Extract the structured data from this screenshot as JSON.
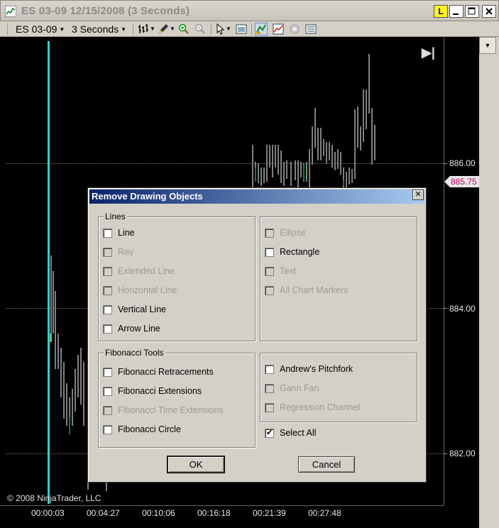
{
  "window": {
    "title": "ES 03-09  12/15/2008 (3 Seconds)",
    "buttons": {
      "L": "L",
      "minimize": "minimize",
      "maximize": "maximize",
      "close": "close"
    }
  },
  "toolbar": {
    "instrument": "ES 03-09",
    "interval": "3 Seconds",
    "icons": [
      "bar-type-icon",
      "pencil-icon",
      "zoom-in-icon",
      "zoom-out-icon",
      "pointer-icon",
      "data-box-icon",
      "properties-icon",
      "indicators-icon",
      "strategy-icon",
      "list-icon"
    ]
  },
  "chart": {
    "price_labels": [
      "886.00",
      "884.00",
      "882.00"
    ],
    "current_price": "885.75",
    "time_labels": [
      "00:00:03",
      "00:04:27",
      "00:10:06",
      "00:16:18",
      "00:21:39",
      "00:27:48"
    ],
    "copyright": "© 2008 NinjaTrader, LLC"
  },
  "dialog": {
    "title": "Remove Drawing Objects",
    "lines_group": {
      "label": "Lines",
      "items": [
        {
          "label": "Line",
          "enabled": true,
          "checked": false
        },
        {
          "label": "Ray",
          "enabled": false,
          "checked": false
        },
        {
          "label": "Extended Line",
          "enabled": false,
          "checked": false
        },
        {
          "label": "Horizontal Line",
          "enabled": false,
          "checked": false
        },
        {
          "label": "Vertical Line",
          "enabled": true,
          "checked": false
        },
        {
          "label": "Arrow Line",
          "enabled": true,
          "checked": false
        }
      ]
    },
    "shapes_group": {
      "items": [
        {
          "label": "Ellipse",
          "enabled": false,
          "checked": false
        },
        {
          "label": "Rectangle",
          "enabled": true,
          "checked": false
        },
        {
          "label": "Text",
          "enabled": false,
          "checked": false
        },
        {
          "label": "All Chart Markers",
          "enabled": false,
          "checked": false
        }
      ]
    },
    "fib_group": {
      "label": "Fibonacci Tools",
      "items": [
        {
          "label": "Fibonacci Retracements",
          "enabled": true,
          "checked": false
        },
        {
          "label": "Fibonacci Extensions",
          "enabled": true,
          "checked": false
        },
        {
          "label": "Fibonacci Time Extensions",
          "enabled": false,
          "checked": false
        },
        {
          "label": "Fibonacci Circle",
          "enabled": true,
          "checked": false
        }
      ]
    },
    "other_group": {
      "items": [
        {
          "label": "Andrew's Pitchfork",
          "enabled": true,
          "checked": false
        },
        {
          "label": "Gann Fan",
          "enabled": false,
          "checked": false
        },
        {
          "label": "Regression Channel",
          "enabled": false,
          "checked": false
        }
      ]
    },
    "select_all": {
      "label": "Select All",
      "checked": true
    },
    "ok_label": "OK",
    "cancel_label": "Cancel"
  }
}
